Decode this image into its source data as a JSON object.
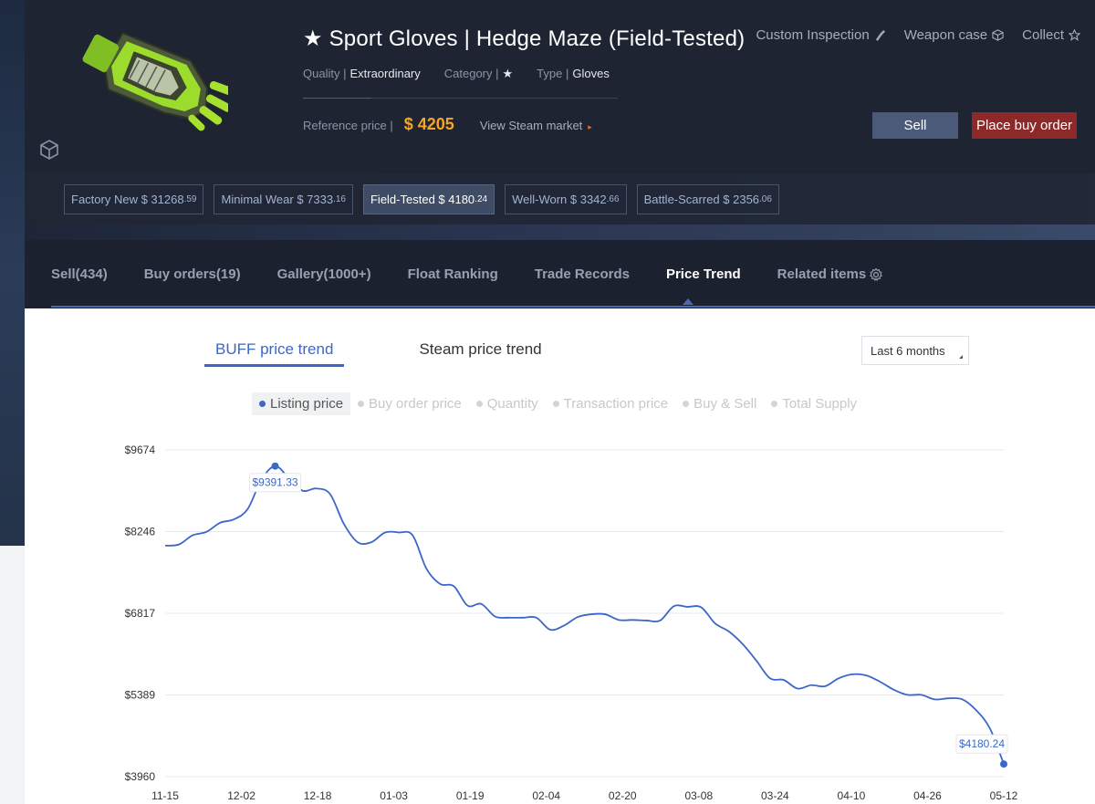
{
  "item": {
    "title": "★ Sport Gloves | Hedge Maze (Field-Tested)",
    "quality_label": "Quality |",
    "quality_value": "Extraordinary",
    "category_label": "Category |",
    "category_value": "★",
    "type_label": "Type |",
    "type_value": "Gloves",
    "reference_label": "Reference price |",
    "reference_price": "$ 4205",
    "steam_link": "View Steam market",
    "icon": "glove-image"
  },
  "top_actions": {
    "inspect": "Custom Inspection",
    "case": "Weapon case",
    "collect": "Collect"
  },
  "buttons": {
    "sell": "Sell",
    "buy_order": "Place buy order"
  },
  "wears": [
    {
      "name": "Factory New $ 31268",
      "dec": ".59",
      "active": false
    },
    {
      "name": "Minimal Wear $ 7333",
      "dec": ".16",
      "active": false
    },
    {
      "name": "Field-Tested $ 4180",
      "dec": ".24",
      "active": true
    },
    {
      "name": "Well-Worn $ 3342",
      "dec": ".66",
      "active": false
    },
    {
      "name": "Battle-Scarred $ 2356",
      "dec": ".06",
      "active": false
    }
  ],
  "tabs": [
    "Sell(434)",
    "Buy orders(19)",
    "Gallery(1000+)",
    "Float Ranking",
    "Trade Records",
    "Price Trend",
    "Related items"
  ],
  "active_tab": "Price Trend",
  "trend_tabs": [
    "BUFF price trend",
    "Steam price trend"
  ],
  "range": "Last 6 months",
  "legend": [
    "Listing price",
    "Buy order price",
    "Quantity",
    "Transaction price",
    "Buy & Sell",
    "Total Supply"
  ],
  "colors": {
    "accent": "#3b67c9",
    "price": "#f5a623",
    "buy_button": "#8d2a29",
    "sell_button": "#4a5a78"
  },
  "chart_data": {
    "type": "line",
    "series": [
      {
        "name": "Listing price",
        "points": [
          [
            "11-15",
            8000
          ],
          [
            "11-18",
            8020
          ],
          [
            "11-21",
            8180
          ],
          [
            "11-24",
            8240
          ],
          [
            "11-27",
            8400
          ],
          [
            "11-30",
            8460
          ],
          [
            "12-02",
            8640
          ],
          [
            "12-05",
            9150
          ],
          [
            "12-07",
            9391.33
          ],
          [
            "12-10",
            9180
          ],
          [
            "12-13",
            8960
          ],
          [
            "12-16",
            9000
          ],
          [
            "12-18",
            8900
          ],
          [
            "12-21",
            8380
          ],
          [
            "12-24",
            8060
          ],
          [
            "12-27",
            8060
          ],
          [
            "12-30",
            8230
          ],
          [
            "01-01",
            8230
          ],
          [
            "01-03",
            8180
          ],
          [
            "01-06",
            7600
          ],
          [
            "01-09",
            7330
          ],
          [
            "01-12",
            7290
          ],
          [
            "01-15",
            6950
          ],
          [
            "01-18",
            6980
          ],
          [
            "01-21",
            6760
          ],
          [
            "01-24",
            6740
          ],
          [
            "01-27",
            6740
          ],
          [
            "01-30",
            6740
          ],
          [
            "02-02",
            6530
          ],
          [
            "02-05",
            6600
          ],
          [
            "02-08",
            6750
          ],
          [
            "02-11",
            6800
          ],
          [
            "02-14",
            6800
          ],
          [
            "02-17",
            6700
          ],
          [
            "02-20",
            6700
          ],
          [
            "02-23",
            6690
          ],
          [
            "02-26",
            6690
          ],
          [
            "03-01",
            6940
          ],
          [
            "03-04",
            6930
          ],
          [
            "03-07",
            6920
          ],
          [
            "03-10",
            6640
          ],
          [
            "03-13",
            6500
          ],
          [
            "03-16",
            6280
          ],
          [
            "03-19",
            5990
          ],
          [
            "03-22",
            5680
          ],
          [
            "03-25",
            5650
          ],
          [
            "03-28",
            5500
          ],
          [
            "03-31",
            5560
          ],
          [
            "04-03",
            5540
          ],
          [
            "04-06",
            5680
          ],
          [
            "04-09",
            5750
          ],
          [
            "04-12",
            5730
          ],
          [
            "04-15",
            5620
          ],
          [
            "04-18",
            5480
          ],
          [
            "04-21",
            5390
          ],
          [
            "04-24",
            5390
          ],
          [
            "04-27",
            5310
          ],
          [
            "04-30",
            5330
          ],
          [
            "05-03",
            5310
          ],
          [
            "05-06",
            5120
          ],
          [
            "05-09",
            4800
          ],
          [
            "05-12",
            4180.24
          ]
        ]
      }
    ],
    "yticks": [
      "$9674",
      "$8246",
      "$6817",
      "$5389",
      "$3960"
    ],
    "ylim": [
      3960,
      9674
    ],
    "xticks": [
      "11-15",
      "12-02",
      "12-18",
      "01-03",
      "01-19",
      "02-04",
      "02-20",
      "03-08",
      "03-24",
      "04-10",
      "04-26",
      "05-12"
    ],
    "annotations": [
      {
        "label": "$9391.33",
        "x": "12-07",
        "y": 9391.33
      },
      {
        "label": "$4180.24",
        "x": "05-12",
        "y": 4180.24
      }
    ],
    "grid": true
  }
}
